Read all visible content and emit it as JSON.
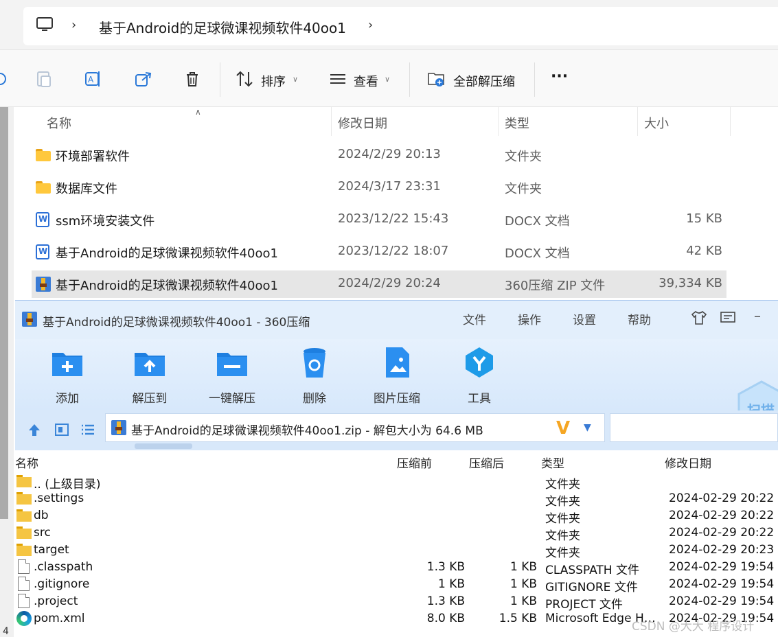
{
  "explorer": {
    "address_path": "基于Android的足球微课视频软件40oo1",
    "toolbar": {
      "sort_label": "排序",
      "view_label": "查看",
      "extract_all_label": "全部解压缩",
      "more_label": "···"
    },
    "columns": {
      "name": "名称",
      "modified": "修改日期",
      "type": "类型",
      "size": "大小"
    },
    "files": [
      {
        "name": "环境部署软件",
        "date": "2024/2/29 20:13",
        "type": "文件夹",
        "size": "",
        "icon": "folder-icon"
      },
      {
        "name": "数据库文件",
        "date": "2024/3/17 23:31",
        "type": "文件夹",
        "size": "",
        "icon": "folder-icon"
      },
      {
        "name": "ssm环境安装文件",
        "date": "2023/12/22 15:43",
        "type": "DOCX 文档",
        "size": "15 KB",
        "icon": "word-doc-icon"
      },
      {
        "name": "基于Android的足球微课视频软件40oo1",
        "date": "2023/12/22 18:07",
        "type": "DOCX 文档",
        "size": "42 KB",
        "icon": "word-doc-icon"
      },
      {
        "name": "基于Android的足球微课视频软件40oo1",
        "date": "2024/2/29 20:24",
        "type": "360压缩 ZIP 文件",
        "size": "39,334 KB",
        "icon": "zip-archive-icon",
        "selected": true
      }
    ]
  },
  "zip": {
    "title": "基于Android的足球微课视频软件40oo1 - 360压缩",
    "menu": [
      "文件",
      "操作",
      "设置",
      "帮助"
    ],
    "toolbar": [
      "添加",
      "解压到",
      "一键解压",
      "删除",
      "图片压缩",
      "工具"
    ],
    "scan_label": "扫描",
    "path": "基于Android的足球微课视频软件40oo1.zip - 解包大小为 64.6 MB",
    "columns": {
      "name": "名称",
      "before": "压缩前",
      "after": "压缩后",
      "type": "类型",
      "modified": "修改日期"
    },
    "files": [
      {
        "name": ".. (上级目录)",
        "before": "",
        "after": "",
        "type": "文件夹",
        "date": "",
        "icon": "folder-icon"
      },
      {
        "name": ".settings",
        "before": "",
        "after": "",
        "type": "文件夹",
        "date": "2024-02-29 20:22",
        "icon": "folder-icon"
      },
      {
        "name": "db",
        "before": "",
        "after": "",
        "type": "文件夹",
        "date": "2024-02-29 20:22",
        "icon": "folder-icon"
      },
      {
        "name": "src",
        "before": "",
        "after": "",
        "type": "文件夹",
        "date": "2024-02-29 20:22",
        "icon": "folder-icon"
      },
      {
        "name": "target",
        "before": "",
        "after": "",
        "type": "文件夹",
        "date": "2024-02-29 20:23",
        "icon": "folder-icon"
      },
      {
        "name": ".classpath",
        "before": "1.3 KB",
        "after": "1 KB",
        "type": "CLASSPATH 文件",
        "date": "2024-02-29 19:54",
        "icon": "file-icon"
      },
      {
        "name": ".gitignore",
        "before": "1 KB",
        "after": "1 KB",
        "type": "GITIGNORE 文件",
        "date": "2024-02-29 19:54",
        "icon": "file-icon"
      },
      {
        "name": ".project",
        "before": "1.3 KB",
        "after": "1 KB",
        "type": "PROJECT 文件",
        "date": "2024-02-29 19:54",
        "icon": "file-icon"
      },
      {
        "name": "pom.xml",
        "before": "8.0 KB",
        "after": "1.5 KB",
        "type": "Microsoft Edge HT...",
        "date": "2024-02-29 19:54",
        "icon": "edge-icon"
      }
    ]
  },
  "watermark": "CSDN @大大 程序设计",
  "corner_text": "4"
}
